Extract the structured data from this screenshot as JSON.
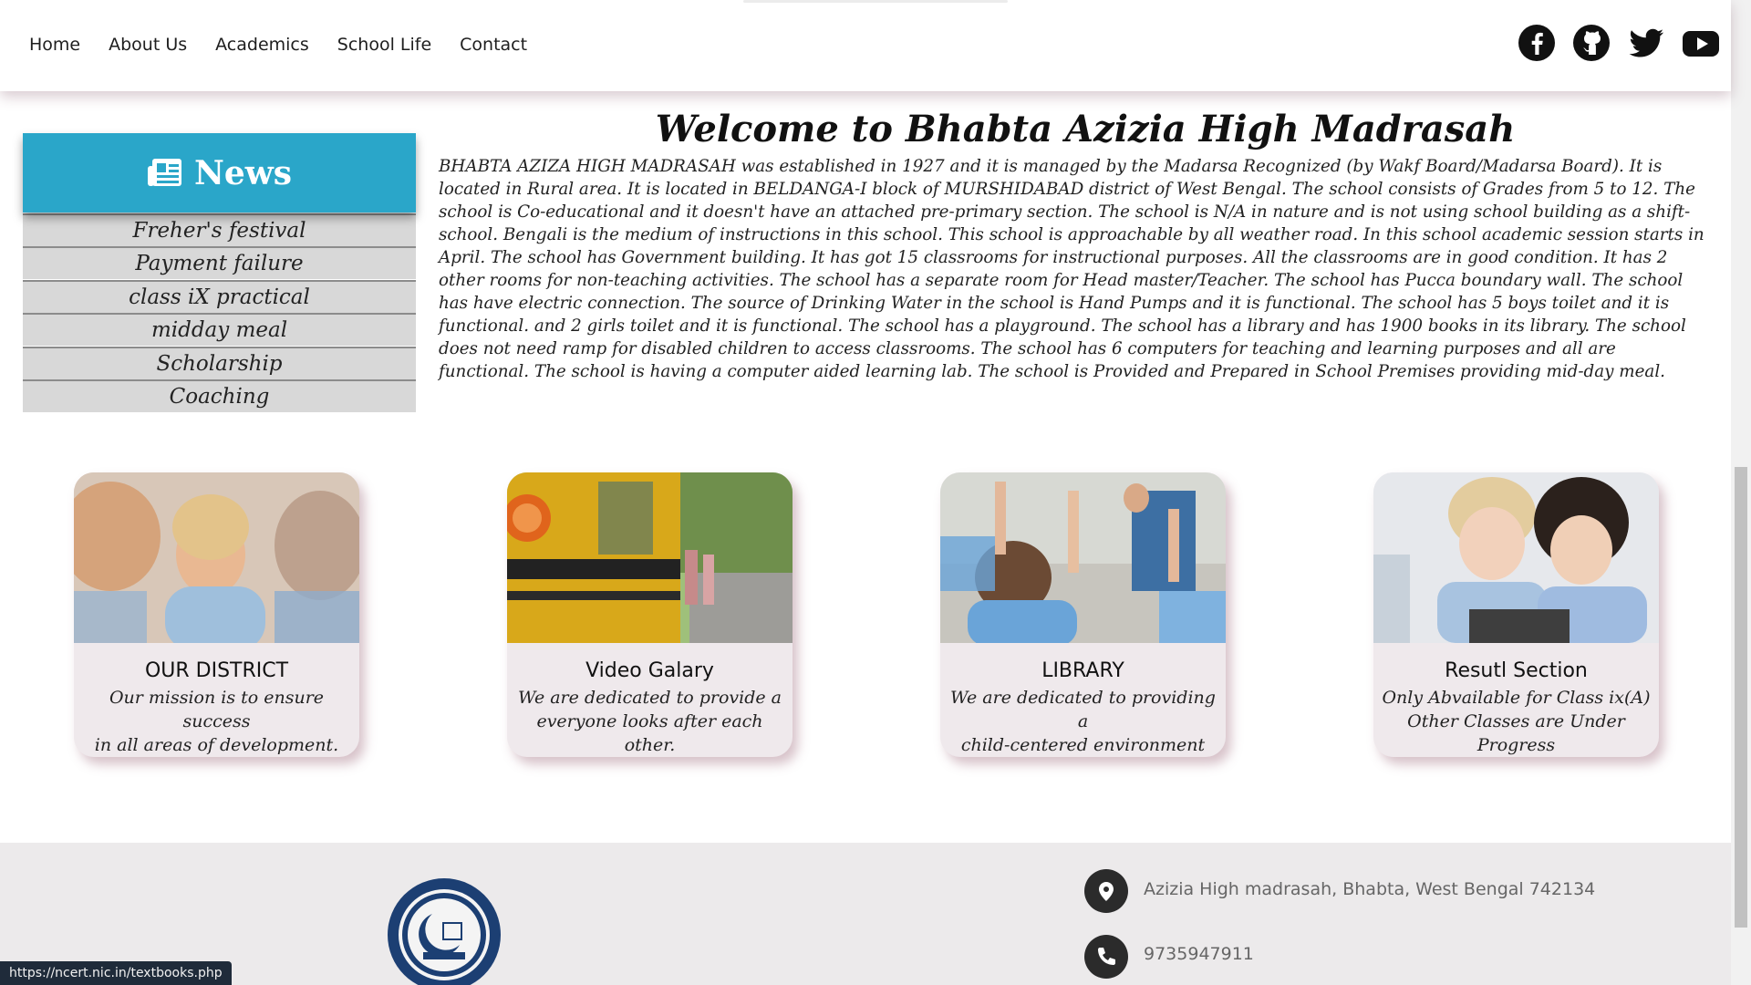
{
  "nav": {
    "items": [
      {
        "label": "Home"
      },
      {
        "label": "About Us"
      },
      {
        "label": "Academics"
      },
      {
        "label": "School Life"
      },
      {
        "label": "Contact"
      }
    ]
  },
  "social": [
    "facebook-icon",
    "github-icon",
    "twitter-icon",
    "youtube-icon"
  ],
  "news": {
    "title": "News",
    "items": [
      {
        "label": "Freher's festival"
      },
      {
        "label": "Payment failure"
      },
      {
        "label": "class iX practical"
      },
      {
        "label": "midday meal"
      },
      {
        "label": "Scholarship"
      },
      {
        "label": "Coaching"
      }
    ]
  },
  "welcome": {
    "title": "Welcome to Bhabta Azizia High Madrasah",
    "body": "BHABTA AZIZA HIGH MADRASAH was established in 1927 and it is managed by the Madarsa Recognized (by Wakf Board/Madarsa Board). It is located in Rural area. It is located in BELDANGA-I block of MURSHIDABAD district of West Bengal. The school consists of Grades from 5 to 12. The school is Co-educational and it doesn't have an attached pre-primary section. The school is N/A in nature and is not using school building as a shift-school. Bengali is the medium of instructions in this school. This school is approachable by all weather road. In this school academic session starts in April. The school has Government building. It has got 15 classrooms for instructional purposes. All the classrooms are in good condition. It has 2 other rooms for non-teaching activities. The school has a separate room for Head master/Teacher. The school has Pucca boundary wall. The school has have electric connection. The source of Drinking Water in the school is Hand Pumps and it is functional. The school has 5 boys toilet and it is functional. and 2 girls toilet and it is functional. The school has a playground. The school has a library and has 1900 books in its library. The school does not need ramp for disabled children to access classrooms. The school has 6 computers for teaching and learning purposes and all are functional. The school is having a computer aided learning lab. The school is Provided and Prepared in School Premises providing mid-day meal."
  },
  "cards": [
    {
      "title": "OUR DISTRICT",
      "line1": "Our mission is to ensure success",
      "line2": "in all areas of development."
    },
    {
      "title": "Video Galary",
      "line1": "We are dedicated to provide a",
      "line2": "everyone looks after each other."
    },
    {
      "title": "LIBRARY",
      "line1": "We are dedicated to providing a",
      "line2": "child-centered environment"
    },
    {
      "title": "Resutl Section",
      "line1": "Only Abvailable for Class ix(A)",
      "line2": "Other Classes are Under Progress"
    }
  ],
  "footer": {
    "address": "Azizia High madrasah, Bhabta, West Bengal 742134",
    "phone": "9735947911"
  },
  "status_url": "https://ncert.nic.in/textbooks.php"
}
